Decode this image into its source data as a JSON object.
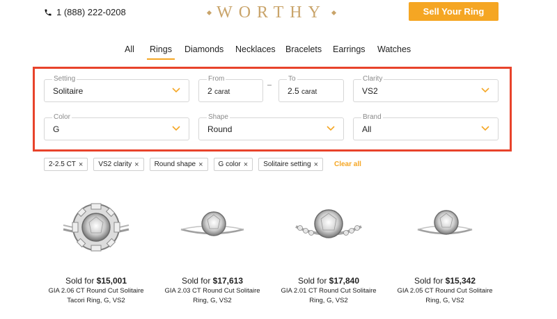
{
  "header": {
    "phone": "1 (888) 222-0208",
    "logo": "WORTHY",
    "sell_button": "Sell Your Ring"
  },
  "tabs": [
    {
      "label": "All",
      "active": false
    },
    {
      "label": "Rings",
      "active": true
    },
    {
      "label": "Diamonds",
      "active": false
    },
    {
      "label": "Necklaces",
      "active": false
    },
    {
      "label": "Bracelets",
      "active": false
    },
    {
      "label": "Earrings",
      "active": false
    },
    {
      "label": "Watches",
      "active": false
    }
  ],
  "filters": {
    "setting": {
      "label": "Setting",
      "value": "Solitaire"
    },
    "from": {
      "label": "From",
      "value": "2",
      "unit": "carat"
    },
    "to": {
      "label": "To",
      "value": "2.5",
      "unit": "carat"
    },
    "clarity": {
      "label": "Clarity",
      "value": "VS2"
    },
    "color": {
      "label": "Color",
      "value": "G"
    },
    "shape": {
      "label": "Shape",
      "value": "Round"
    },
    "brand": {
      "label": "Brand",
      "value": "All"
    }
  },
  "chips": [
    "2-2.5 CT",
    "VS2 clarity",
    "Round shape",
    "G color",
    "Solitaire setting"
  ],
  "clear_all": "Clear all",
  "products": [
    {
      "sold_prefix": "Sold for",
      "price": "$15,001",
      "line1": "GIA 2.06 CT Round Cut Solitaire",
      "line2": "Tacori Ring, G, VS2"
    },
    {
      "sold_prefix": "Sold for",
      "price": "$17,613",
      "line1": "GIA 2.03 CT Round Cut Solitaire",
      "line2": "Ring, G, VS2"
    },
    {
      "sold_prefix": "Sold for",
      "price": "$17,840",
      "line1": "GIA 2.01 CT Round Cut Solitaire",
      "line2": "Ring, G, VS2"
    },
    {
      "sold_prefix": "Sold for",
      "price": "$15,342",
      "line1": "GIA 2.05 CT Round Cut Solitaire",
      "line2": "Ring, G, VS2"
    }
  ],
  "colors": {
    "accent": "#f5a623",
    "logo_gold": "#c9a46a",
    "highlight_border": "#e8432b"
  },
  "icons": [
    "phone-icon",
    "chevron-down-icon",
    "close-icon",
    "ring-image"
  ]
}
